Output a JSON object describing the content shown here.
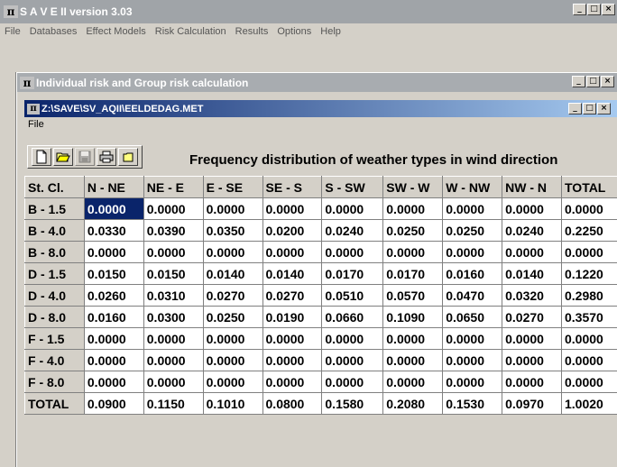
{
  "app": {
    "title": "S A V E  II version 3.03",
    "menu": [
      "File",
      "Databases",
      "Effect Models",
      "Risk Calculation",
      "Results",
      "Options",
      "Help"
    ]
  },
  "child_window": {
    "title": "Individual risk and Group risk calculation"
  },
  "doc_window": {
    "title": "Z:\\SAVE\\SV_AQII\\EELDEDAG.MET",
    "menu": [
      "File"
    ]
  },
  "toolbar": {
    "icons": [
      "new-file-icon",
      "open-folder-icon",
      "save-disk-icon",
      "print-icon",
      "blank-icon"
    ]
  },
  "heading": "Frequency distribution of weather types in wind direction",
  "table": {
    "headers": [
      "St. Cl.",
      "N - NE",
      "NE - E",
      "E - SE",
      "SE - S",
      "S - SW",
      "SW - W",
      "W - NW",
      "NW - N",
      "TOTAL"
    ],
    "rows": [
      {
        "label": "B - 1.5",
        "values": [
          "0.0000",
          "0.0000",
          "0.0000",
          "0.0000",
          "0.0000",
          "0.0000",
          "0.0000",
          "0.0000",
          "0.0000"
        ]
      },
      {
        "label": "B - 4.0",
        "values": [
          "0.0330",
          "0.0390",
          "0.0350",
          "0.0200",
          "0.0240",
          "0.0250",
          "0.0250",
          "0.0240",
          "0.2250"
        ]
      },
      {
        "label": "B - 8.0",
        "values": [
          "0.0000",
          "0.0000",
          "0.0000",
          "0.0000",
          "0.0000",
          "0.0000",
          "0.0000",
          "0.0000",
          "0.0000"
        ]
      },
      {
        "label": "D - 1.5",
        "values": [
          "0.0150",
          "0.0150",
          "0.0140",
          "0.0140",
          "0.0170",
          "0.0170",
          "0.0160",
          "0.0140",
          "0.1220"
        ]
      },
      {
        "label": "D - 4.0",
        "values": [
          "0.0260",
          "0.0310",
          "0.0270",
          "0.0270",
          "0.0510",
          "0.0570",
          "0.0470",
          "0.0320",
          "0.2980"
        ]
      },
      {
        "label": "D - 8.0",
        "values": [
          "0.0160",
          "0.0300",
          "0.0250",
          "0.0190",
          "0.0660",
          "0.1090",
          "0.0650",
          "0.0270",
          "0.3570"
        ]
      },
      {
        "label": "F - 1.5",
        "values": [
          "0.0000",
          "0.0000",
          "0.0000",
          "0.0000",
          "0.0000",
          "0.0000",
          "0.0000",
          "0.0000",
          "0.0000"
        ]
      },
      {
        "label": "F - 4.0",
        "values": [
          "0.0000",
          "0.0000",
          "0.0000",
          "0.0000",
          "0.0000",
          "0.0000",
          "0.0000",
          "0.0000",
          "0.0000"
        ]
      },
      {
        "label": "F - 8.0",
        "values": [
          "0.0000",
          "0.0000",
          "0.0000",
          "0.0000",
          "0.0000",
          "0.0000",
          "0.0000",
          "0.0000",
          "0.0000"
        ]
      },
      {
        "label": "TOTAL",
        "values": [
          "0.0900",
          "0.1150",
          "0.1010",
          "0.0800",
          "0.1580",
          "0.2080",
          "0.1530",
          "0.0970",
          "1.0020"
        ]
      }
    ]
  }
}
